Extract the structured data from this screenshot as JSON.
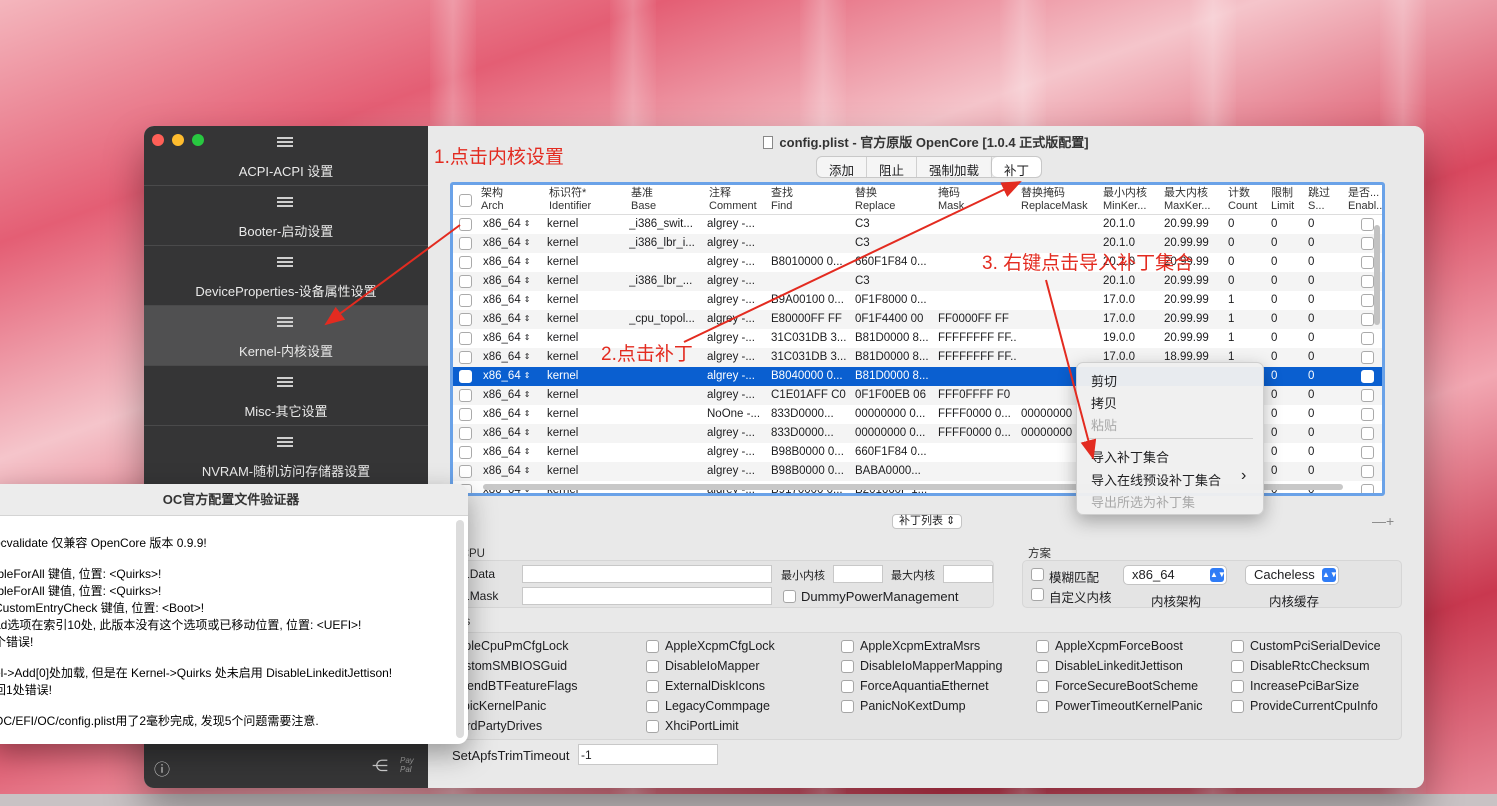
{
  "window": {
    "title": "config.plist - 官方原版 OpenCore [1.0.4 正式版配置]"
  },
  "sidebar": {
    "items": [
      {
        "label": "ACPI-ACPI 设置"
      },
      {
        "label": "Booter-启动设置"
      },
      {
        "label": "DeviceProperties-设备属性设置"
      },
      {
        "label": "Kernel-内核设置"
      },
      {
        "label": "Misc-其它设置"
      },
      {
        "label": "NVRAM-随机访问存储器设置"
      }
    ],
    "footer_text": "Pay Pal"
  },
  "tabs": [
    "添加",
    "阻止",
    "强制加载",
    "补丁"
  ],
  "table": {
    "headers": [
      [
        "架构",
        "Arch"
      ],
      [
        "标识符*",
        "Identifier"
      ],
      [
        "基准",
        "Base"
      ],
      [
        "注释",
        "Comment"
      ],
      [
        "查找",
        "Find"
      ],
      [
        "替换",
        "Replace"
      ],
      [
        "掩码",
        "Mask"
      ],
      [
        "替换掩码",
        "ReplaceMask"
      ],
      [
        "最小内核",
        "MinKer..."
      ],
      [
        "最大内核",
        "MaxKer..."
      ],
      [
        "计数",
        "Count"
      ],
      [
        "限制",
        "Limit"
      ],
      [
        "跳过",
        "S..."
      ],
      [
        "是否...",
        "Enabl..."
      ]
    ],
    "rows": [
      [
        "x86_64",
        "kernel",
        "_i386_swit...",
        "algrey -...",
        "",
        "C3",
        "",
        "",
        "20.1.0",
        "20.99.99",
        "0",
        "0",
        "0"
      ],
      [
        "x86_64",
        "kernel",
        "_i386_lbr_i...",
        "algrey -...",
        "",
        "C3",
        "",
        "",
        "20.1.0",
        "20.99.99",
        "0",
        "0",
        "0"
      ],
      [
        "x86_64",
        "kernel",
        "",
        "algrey -...",
        "B8010000 0...",
        "660F1F84 0...",
        "",
        "",
        "20.1.0",
        "20.99.99",
        "0",
        "0",
        "0"
      ],
      [
        "x86_64",
        "kernel",
        "_i386_lbr_...",
        "algrey -...",
        "",
        "C3",
        "",
        "",
        "20.1.0",
        "20.99.99",
        "0",
        "0",
        "0"
      ],
      [
        "x86_64",
        "kernel",
        "",
        "algrey -...",
        "B9A00100 0...",
        "0F1F8000 0...",
        "",
        "",
        "17.0.0",
        "20.99.99",
        "1",
        "0",
        "0"
      ],
      [
        "x86_64",
        "kernel",
        "_cpu_topol...",
        "algrey -...",
        "E80000FF FF",
        "0F1F4400 00",
        "FF0000FF FF",
        "",
        "17.0.0",
        "20.99.99",
        "1",
        "0",
        "0"
      ],
      [
        "x86_64",
        "kernel",
        "",
        "algrey -...",
        "31C031DB 3...",
        "B81D0000 8...",
        "FFFFFFFF FF...",
        "",
        "19.0.0",
        "20.99.99",
        "1",
        "0",
        "0"
      ],
      [
        "x86_64",
        "kernel",
        "",
        "algrey -...",
        "31C031DB 3...",
        "B81D0000 8...",
        "FFFFFFFF FF...",
        "",
        "17.0.0",
        "18.99.99",
        "1",
        "0",
        "0"
      ],
      [
        "x86_64",
        "kernel",
        "",
        "algrey -...",
        "B8040000 0...",
        "B81D0000 8...",
        "",
        "",
        "",
        "",
        "",
        "0",
        "0"
      ],
      [
        "x86_64",
        "kernel",
        "",
        "algrey -...",
        "C1E01AFF C0",
        "0F1F00EB 06",
        "FFF0FFFF F0",
        "",
        "",
        "",
        "",
        "0",
        "0"
      ],
      [
        "x86_64",
        "kernel",
        "",
        "NoOne -...",
        "833D0000...",
        "00000000 0...",
        "FFFF0000 0...",
        "00000000",
        "",
        "",
        "",
        "0",
        "0"
      ],
      [
        "x86_64",
        "kernel",
        "",
        "algrey -...",
        "833D0000...",
        "00000000 0...",
        "FFFF0000 0...",
        "00000000",
        "",
        "",
        "",
        "0",
        "0"
      ],
      [
        "x86_64",
        "kernel",
        "",
        "algrey -...",
        "B98B0000 0...",
        "660F1F84 0...",
        "",
        "",
        "",
        "",
        "",
        "0",
        "0"
      ],
      [
        "x86_64",
        "kernel",
        "",
        "algrey -...",
        "B98B0000 0...",
        "BABA0000...",
        "",
        "",
        "",
        "",
        "",
        "0",
        "0"
      ],
      [
        "x86_64",
        "kernel",
        "",
        "algrey -...",
        "B9170000 0...",
        "B201660F 1...",
        "",
        "",
        "",
        "",
        "",
        "0",
        "0"
      ]
    ],
    "selected_row": 8,
    "list_popup": "补丁列表"
  },
  "cpu": {
    "title": "冒 CPU",
    "cpuid1data_label": "uid1Data",
    "cpuid1mask_label": "uid1Mask",
    "min_kernel_label": "最小内核",
    "max_kernel_label": "最大内核",
    "dummy_label": "DummyPowerManagement"
  },
  "scheme": {
    "title": "方案",
    "fuzzy_label": "模糊匹配",
    "custom_kernel_label": "自定义内核",
    "arch_value": "x86_64",
    "arch_label": "内核架构",
    "cache_value": "Cacheless",
    "cache_label": "内核缓存"
  },
  "quirks": {
    "title": "uirks",
    "items": [
      "AppleCpuPmCfgLock",
      "AppleXcpmCfgLock",
      "AppleXcpmExtraMsrs",
      "AppleXcpmForceBoost",
      "CustomPciSerialDevice",
      "CustomSMBIOSGuid",
      "DisableIoMapper",
      "DisableIoMapperMapping",
      "DisableLinkeditJettison",
      "DisableRtcChecksum",
      "ExtendBTFeatureFlags",
      "ExternalDiskIcons",
      "ForceAquantiaEthernet",
      "ForceSecureBootScheme",
      "IncreasePciBarSize",
      "LapicKernelPanic",
      "LegacyCommpage",
      "PanicNoKextDump",
      "PowerTimeoutKernelPanic",
      "ProvideCurrentCpuInfo",
      "ThirdPartyDrives",
      "XhciPortLimit"
    ],
    "apfs_label": "SetApfsTrimTimeout",
    "apfs_value": "-1"
  },
  "context_menu": {
    "items": [
      "剪切",
      "拷贝",
      "粘贴",
      "导入补丁集合",
      "导入在线预设补丁集合",
      "导出所选为补丁集"
    ],
    "submenu_arrow": "›"
  },
  "validator": {
    "title": "OC官方配置文件验证器",
    "lines": [
      "ocvalidate 仅兼容 OpenCore 版本 0.9.9!",
      "ıbleForAll 键值, 位置: <Quirks>!",
      "ıbleForAll 键值, 位置: <Quirks>!",
      "CustomEntryCheck 键值, 位置: <Boot>!",
      "ad选项在索引10处, 此版本没有这个选项或已移动位置, 位置: <UEFI>!",
      "个错误!",
      "el->Add[0]处加载, 但是在 Kernel->Quirks 处未启用 DisableLinkeditJettison!",
      "回1处错误!",
      "OC/EFI/OC/config.plist用了2毫秒完成, 发现5个问题需要注意."
    ]
  },
  "annotations": {
    "step1": "1.点击内核设置",
    "step2": "2.点击补丁",
    "step3": "3. 右键点击导入补丁集合"
  },
  "colors": {
    "accent": "#0a5fd0",
    "annotation": "#e32b20",
    "sidebar": "#353536"
  }
}
